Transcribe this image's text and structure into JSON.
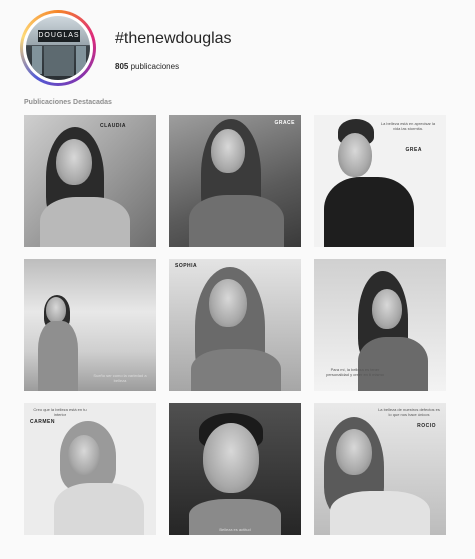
{
  "profile": {
    "hashtag": "#thenewdouglas",
    "post_count": "805",
    "posts_suffix": "publicaciones",
    "avatar_sign_text": "DOUGLAS"
  },
  "highlights": {
    "section_title": "Publicaciones Destacadas",
    "tiles": [
      {
        "name": "CLAUDIA",
        "quote": ""
      },
      {
        "name": "GRACE",
        "quote": ""
      },
      {
        "name": "GREA",
        "quote": "La belleza está en aprecisar la vida las stormita."
      },
      {
        "name": "",
        "quote": "Sueño ser como la variedad a belleza"
      },
      {
        "name": "SOPHIA",
        "quote": ""
      },
      {
        "name": "",
        "quote": "Para mí, la belleza es tener personalidad y creer en ti mismo"
      },
      {
        "name": "CARMEN",
        "quote": "Creo que la belleza está en tu interior"
      },
      {
        "name": "",
        "quote": "Belleza es actitud"
      },
      {
        "name": "ROCIO",
        "quote": "La belleza de nuestros defectos es lo que nos hace únicos"
      }
    ]
  },
  "colors": {
    "background": "#fafafa",
    "text": "#262626",
    "muted": "#8e8e8e"
  }
}
